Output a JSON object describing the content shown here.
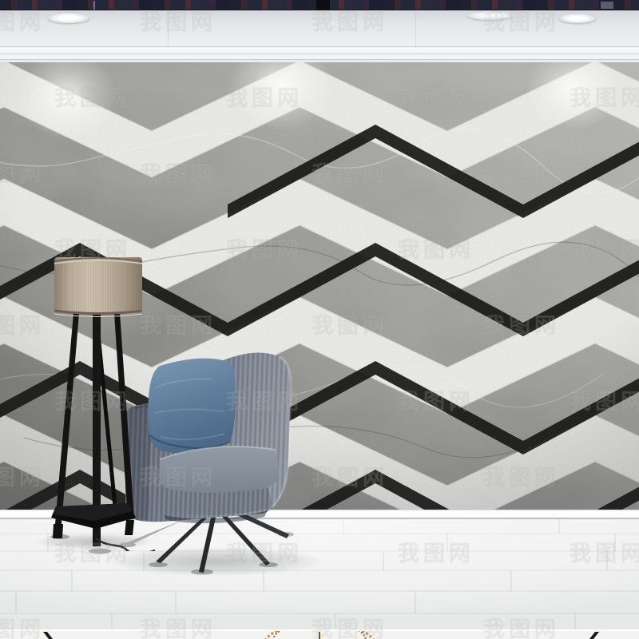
{
  "watermark": {
    "text": "我图网",
    "opacity": 0.36,
    "rows": 9,
    "cols": 4
  },
  "palette": {
    "top_strip": "#232633",
    "ceiling": "#e6e8ea",
    "wall_gray_marble": "#97978f",
    "wall_white_stripe": "#f3f3f1",
    "stripe_black": "#1d1d1b",
    "lamp_shade_beige": "#bcae9b",
    "lamp_frame_black": "#141414",
    "chair_fabric_gray": "#6e7580",
    "pillow_steel_blue": "#5f7d9b",
    "seat_cushion": "#848d98",
    "floor_white_wood": "#f1f2f1",
    "baseboard_white": "#fbfcfc",
    "gold_accent": "#c59a4e"
  }
}
